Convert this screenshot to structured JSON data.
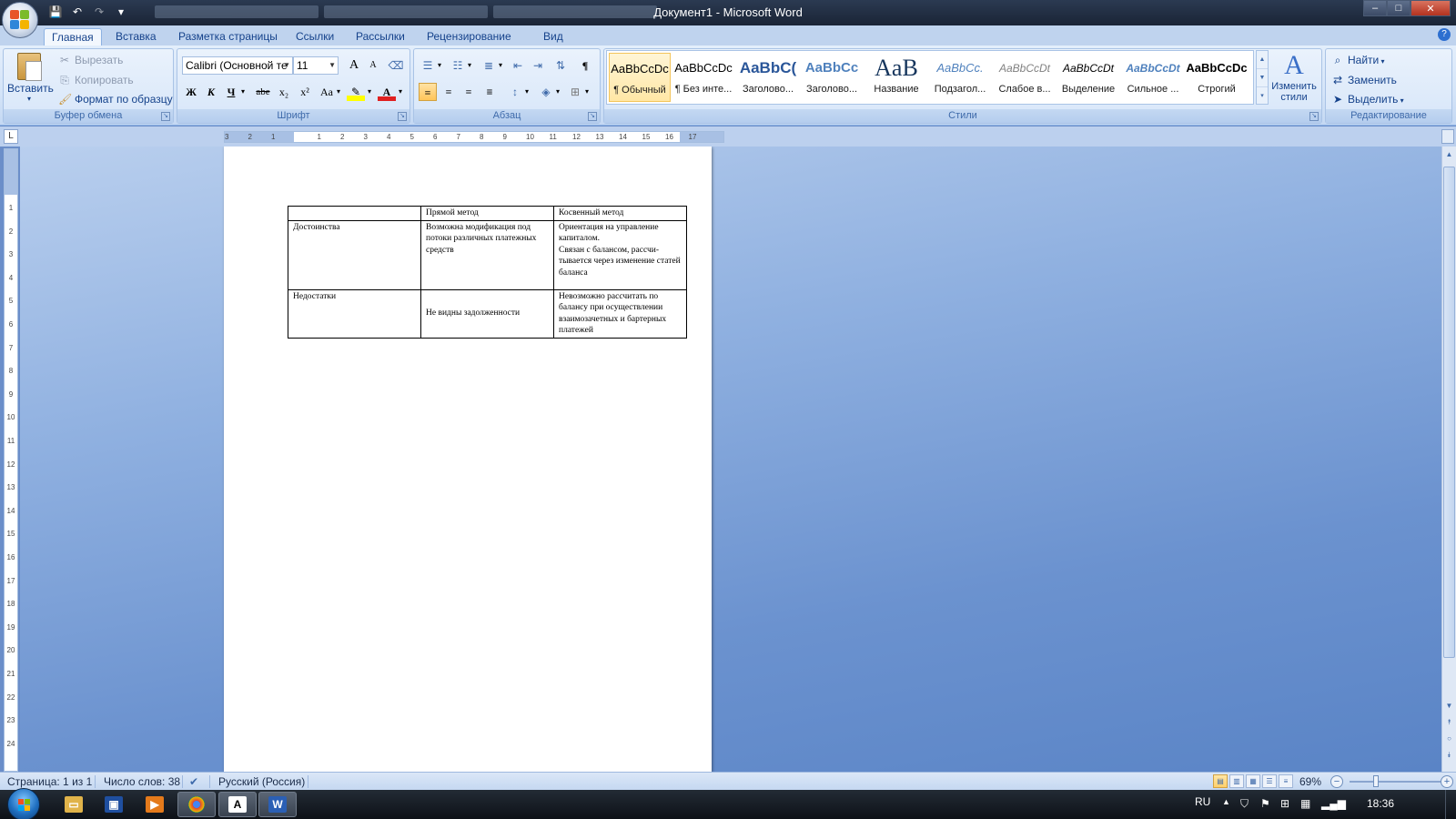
{
  "window": {
    "title": "Документ1 - Microsoft Word",
    "controls": {
      "minimize": "–",
      "maximize": "□",
      "close": "✕"
    }
  },
  "ribbon_tabs": [
    "Главная",
    "Вставка",
    "Разметка страницы",
    "Ссылки",
    "Рассылки",
    "Рецензирование",
    "Вид"
  ],
  "clipboard": {
    "paste": "Вставить",
    "cut": "Вырезать",
    "copy": "Копировать",
    "format_painter": "Формат по образцу",
    "label": "Буфер обмена"
  },
  "font": {
    "family": "Calibri (Основной те",
    "size": "11",
    "grow": "A",
    "shrink": "A",
    "bold": "Ж",
    "italic": "К",
    "underline": "Ч",
    "strike": "abe",
    "subscript": "x₂",
    "superscript": "x²",
    "case": "Aa",
    "color_letter": "A",
    "label": "Шрифт"
  },
  "paragraph": {
    "label": "Абзац"
  },
  "styles": {
    "items": [
      {
        "sample": "AaBbCcDc",
        "name": "¶ Обычный"
      },
      {
        "sample": "AaBbCcDc",
        "name": "¶ Без инте..."
      },
      {
        "sample": "AaBbC(",
        "name": "Заголово..."
      },
      {
        "sample": "AaBbCc",
        "name": "Заголово..."
      },
      {
        "sample": "AaB",
        "name": "Название"
      },
      {
        "sample": "AaBbCc.",
        "name": "Подзагол..."
      },
      {
        "sample": "AaBbCcDt",
        "name": "Слабое в..."
      },
      {
        "sample": "AaBbCcDt",
        "name": "Выделение"
      },
      {
        "sample": "AaBbCcDt",
        "name": "Сильное ..."
      },
      {
        "sample": "AaBbCcDc",
        "name": "Строгий"
      }
    ],
    "change_styles": "Изменить стили",
    "label": "Стили"
  },
  "editing": {
    "find": "Найти",
    "replace": "Заменить",
    "select": "Выделить",
    "label": "Редактирование"
  },
  "ruler": {
    "h_ticks": [
      "3",
      "2",
      "1",
      "1",
      "2",
      "3",
      "4",
      "5",
      "6",
      "7",
      "8",
      "9",
      "10",
      "11",
      "12",
      "13",
      "14",
      "15",
      "16",
      "17"
    ],
    "v_ticks": [
      "1",
      "2",
      "3",
      "4",
      "5",
      "6",
      "7",
      "8",
      "9",
      "10",
      "11",
      "12",
      "13",
      "14",
      "15",
      "16",
      "17",
      "18",
      "19",
      "20",
      "21",
      "22",
      "23",
      "24"
    ]
  },
  "document": {
    "table": [
      [
        "",
        "Прямой метод",
        "Косвенный метод"
      ],
      [
        "Достоинства",
        "Возможна модификация под потоки различных платежных средств",
        "Ориентация на управление капиталом.\nСвязан с балансом, рассчи-тывается через изменение статей баланса"
      ],
      [
        "Недостатки",
        "Не видны задолженности",
        "Невозможно рассчитать по балансу при осуществлении взаимозачетных и бартерных платежей"
      ]
    ]
  },
  "statusbar": {
    "page": "Страница: 1 из 1",
    "words": "Число слов: 38",
    "language": "Русский (Россия)",
    "zoom": "69%",
    "zoom_level": 0.69
  },
  "taskbar": {
    "lang": "RU",
    "time": "18:36"
  },
  "colors": {
    "accent": "#15428b",
    "ribbon": "#d4e4f8",
    "workspace": "#6b92cf"
  }
}
